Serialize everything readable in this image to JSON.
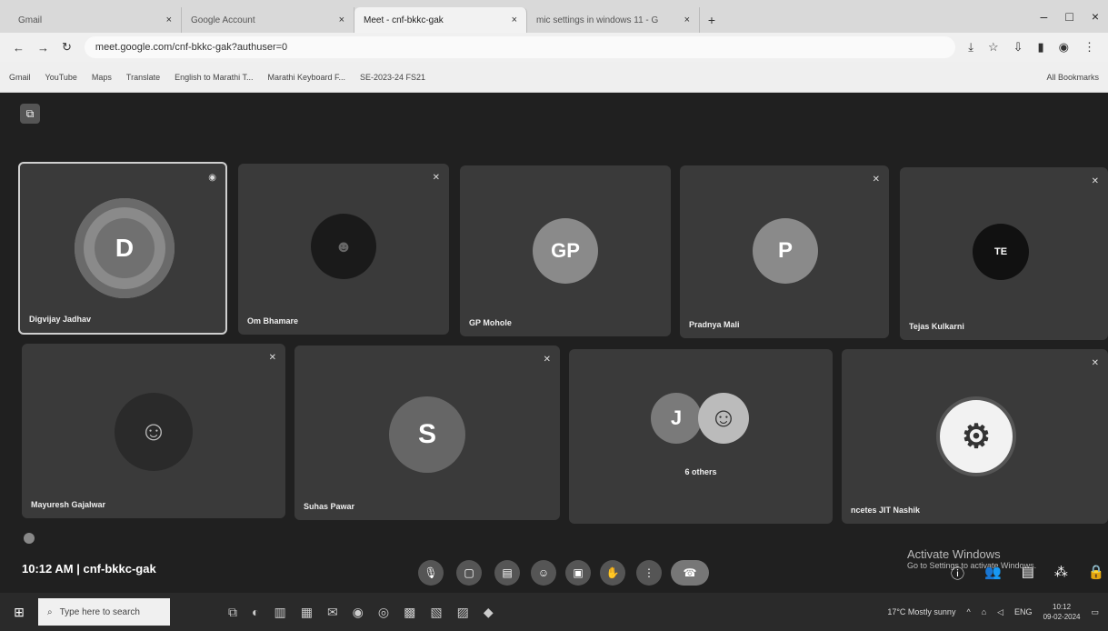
{
  "browser": {
    "tabs": [
      {
        "label": "Gmail"
      },
      {
        "label": "Google Account"
      },
      {
        "label": "Meet - cnf-bkkc-gak"
      },
      {
        "label": "mic settings in windows 11 - G"
      }
    ],
    "url": "meet.google.com/cnf-bkkc-gak?authuser=0",
    "bookmarks": [
      "Gmail",
      "YouTube",
      "Maps",
      "Translate",
      "English to Marathi T...",
      "Marathi Keyboard F...",
      "SE-2023-24 FS21"
    ],
    "all_bookmarks": "All Bookmarks"
  },
  "meeting": {
    "time": "10:12 AM",
    "separator": "|",
    "code": "cnf-bkkc-gak",
    "participants": [
      {
        "name": "Digvijay Jadhav",
        "initial": "D",
        "speaking": true,
        "avatar_color": "#8a8a8a"
      },
      {
        "name": "Om Bhamare",
        "initial": "",
        "avatar_color": "#1a1a1a"
      },
      {
        "name": "GP Mohole",
        "initial": "GP",
        "avatar_color": "#8a8a8a"
      },
      {
        "name": "Pradnya Mali",
        "initial": "P",
        "avatar_color": "#8a8a8a"
      },
      {
        "name": "Tejas Kulkarni",
        "initial": "TE",
        "avatar_color": "#111111"
      },
      {
        "name": "Mayuresh Gajalwar",
        "initial": "",
        "avatar_color": "#2a2a2a"
      },
      {
        "name": "Suhas Pawar",
        "initial": "S",
        "avatar_color": "#666666"
      },
      {
        "name": "6 others",
        "initial": "J",
        "avatar_color": "#7a7a7a"
      },
      {
        "name": "ncetes JIT Nashik",
        "initial": "",
        "avatar_color": "#f2f2f2"
      }
    ]
  },
  "windows": {
    "activate_title": "Activate Windows",
    "activate_sub": "Go to Settings to activate Windows.",
    "search_placeholder": "Type here to search",
    "weather": "17°C Mostly sunny",
    "language": "ENG",
    "clock_time": "10:12",
    "clock_date": "09-02-2024"
  }
}
